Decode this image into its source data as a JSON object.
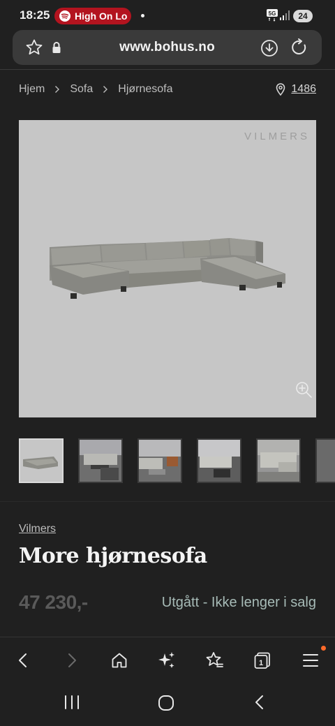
{
  "status_bar": {
    "time": "18:25",
    "media_pill_text": "High On Lo",
    "network": "5G",
    "battery": "24",
    "accent_color": "#b3141f"
  },
  "browser": {
    "url": "www.bohus.no",
    "icons": [
      "star-icon",
      "lock-icon",
      "download-icon",
      "reload-icon"
    ]
  },
  "breadcrumb": {
    "items": [
      "Hjem",
      "Sofa",
      "Hjørnesofa"
    ],
    "store_number": "1486"
  },
  "hero": {
    "brand_watermark": "VILMERS",
    "background_color": "#c6c6c6"
  },
  "thumbnails": {
    "count_visible": 5,
    "active_index": 0
  },
  "product": {
    "brand": "Vilmers",
    "title": "More hjørnesofa",
    "price": "47 230,-",
    "availability": "Utgått - Ikke lenger i salg"
  },
  "bottom_nav": {
    "items": [
      "back-icon",
      "forward-icon",
      "home-icon",
      "ai-sparkle-icon",
      "favorites-icon",
      "tabs-icon",
      "menu-icon"
    ],
    "tabs_count": "1"
  },
  "system_nav": {
    "items": [
      "recents-icon",
      "home-circle-icon",
      "system-back-icon"
    ]
  }
}
